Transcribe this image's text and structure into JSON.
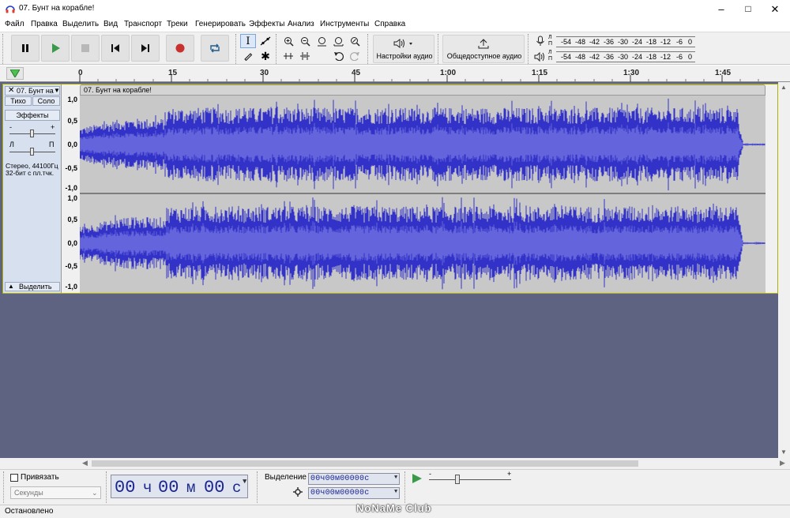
{
  "window": {
    "title": "07. Бунт на корабле!"
  },
  "menu": [
    "Файл",
    "Правка",
    "Выделить",
    "Вид",
    "Транспорт",
    "Треки",
    "Генерировать",
    "Эффекты",
    "Анализ",
    "Инструменты",
    "Справка"
  ],
  "toolbar": {
    "audio_setup_label": "Настройки аудио",
    "share_label": "Общедоступное аудио"
  },
  "meters": {
    "rec_channel": "Л",
    "rec_channel2": "П",
    "play_channel": "Л",
    "play_channel2": "П",
    "scale": [
      "-54",
      "-48",
      "-42",
      "-36",
      "-30",
      "-24",
      "-18",
      "-12",
      "-6",
      "0"
    ]
  },
  "ruler": {
    "ticks": [
      "0",
      "15",
      "30",
      "45",
      "1:00",
      "1:15",
      "1:30",
      "1:45"
    ]
  },
  "track": {
    "name": "07. Бунт на",
    "clip_name": "07. Бунт на корабле!",
    "mute": "Тихо",
    "solo": "Соло",
    "effects": "Эффекты",
    "gain_minus": "-",
    "gain_plus": "+",
    "pan_left": "Л",
    "pan_right": "П",
    "info_line1": "Стерео, 44100Гц",
    "info_line2": "32-бит с пл.тчк.",
    "select": "Выделить",
    "scale": [
      "1,0",
      "0,5",
      "0,0",
      "-0,5",
      "-1,0"
    ]
  },
  "snap": {
    "label": "Привязать",
    "unit": "Секунды",
    "checked": false
  },
  "time": {
    "h": "00",
    "h_unit": "ч",
    "m": "00",
    "m_unit": "м",
    "s": "00",
    "s_unit": "с"
  },
  "selection": {
    "label": "Выделение",
    "start": "00ч00м00000с",
    "end": "00ч00м00000с",
    "speed_minus": "-",
    "speed_plus": "+"
  },
  "status": {
    "text": "Остановлено"
  },
  "watermark": "NoNaMe Club",
  "colors": {
    "wave": "#3232c8",
    "wave_rms": "#6464dc",
    "track_bg": "#5d6380",
    "accent": "#1b2690"
  }
}
